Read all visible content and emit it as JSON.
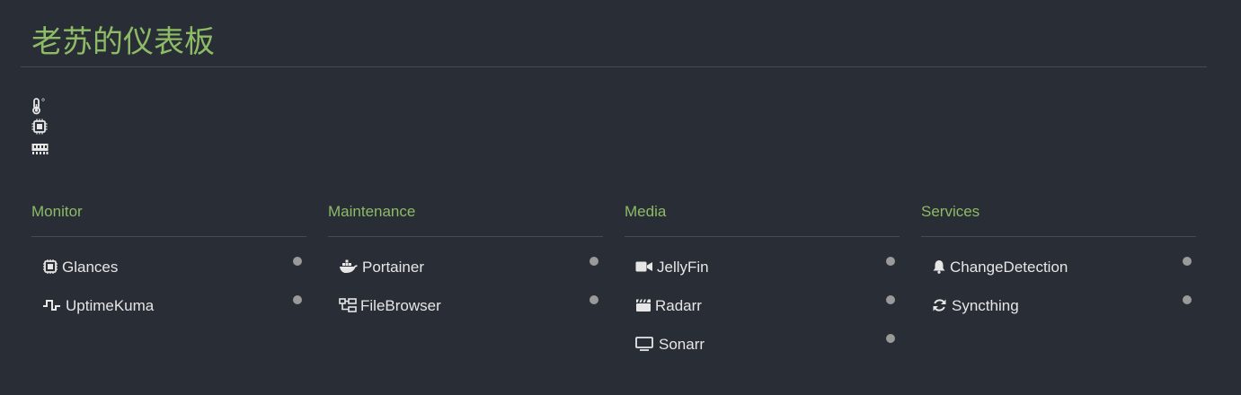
{
  "page": {
    "title": "老苏的仪表板"
  },
  "widgets": [
    {
      "icon": "thermometer-icon",
      "suffix": "°"
    },
    {
      "icon": "cpu-icon"
    },
    {
      "icon": "memory-icon"
    }
  ],
  "groups": [
    {
      "title": "Monitor",
      "services": [
        {
          "label": "Glances",
          "icon": "cpu-icon"
        },
        {
          "label": "UptimeKuma",
          "icon": "pulse-icon"
        }
      ]
    },
    {
      "title": "Maintenance",
      "services": [
        {
          "label": "Portainer",
          "icon": "docker-icon"
        },
        {
          "label": "FileBrowser",
          "icon": "folder-tree-icon"
        }
      ]
    },
    {
      "title": "Media",
      "services": [
        {
          "label": "JellyFin",
          "icon": "video-icon"
        },
        {
          "label": "Radarr",
          "icon": "clapperboard-icon"
        },
        {
          "label": "Sonarr",
          "icon": "tv-icon"
        }
      ]
    },
    {
      "title": "Services",
      "services": [
        {
          "label": "ChangeDetection",
          "icon": "bell-icon"
        },
        {
          "label": "Syncthing",
          "icon": "sync-icon"
        }
      ]
    }
  ],
  "colors": {
    "background": "#292d35",
    "accent": "#8dbb66",
    "text": "#e6e6e6",
    "divider": "#474b53",
    "status_dot": "#9a9a9a"
  }
}
